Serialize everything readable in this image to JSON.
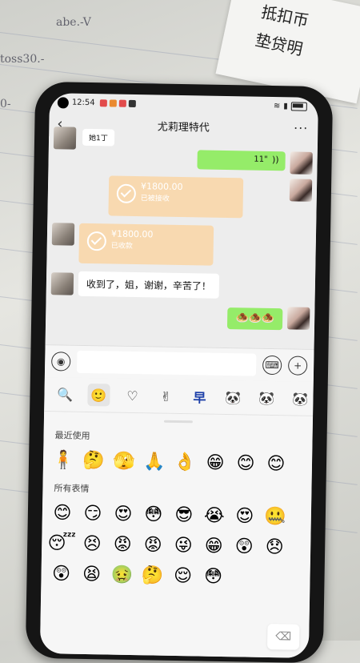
{
  "background": {
    "note_lines": [
      "抵扣币",
      "垫贷明"
    ],
    "scribbles": [
      "abe.-V",
      "toss30.-",
      "0-"
    ]
  },
  "status": {
    "time": "12:54"
  },
  "chat": {
    "title": "尤莉理特代",
    "back_icon": "chevron-left-icon",
    "more_icon": "ellipsis-icon",
    "messages": [
      {
        "side": "left",
        "text": "收到了，姐，谢谢，辛苦了！"
      },
      {
        "side": "right",
        "text": "11\""
      },
      {
        "side": "right",
        "type": "transfer",
        "amount": "¥1800.00",
        "status": "已被接收"
      },
      {
        "side": "left",
        "type": "transfer",
        "amount": "¥1800.00",
        "status": "已收款"
      },
      {
        "side": "right",
        "text": "🧆🧆🧆"
      }
    ],
    "top_partial": "她1丁"
  },
  "input": {
    "placeholder": ""
  },
  "emoji_panel": {
    "tabs": [
      "🔍",
      "🙂",
      "♡",
      "✌",
      "早",
      "🐼",
      "🐼",
      "🐼"
    ],
    "recent_label": "最近使用",
    "all_label": "所有表情",
    "recent": [
      "🧍",
      "🤔",
      "🫣",
      "🙏",
      "👌",
      "😁",
      "😊",
      "😊"
    ],
    "all": [
      "😊",
      "😏",
      "😍",
      "😳",
      "😎",
      "😭",
      "😍",
      "🤐",
      "😴",
      "😣",
      "😡",
      "😡",
      "😜",
      "😁",
      "😲",
      "😞",
      "😲",
      "😫",
      "🤢",
      "🤔",
      "😌",
      "😳",
      "",
      ""
    ]
  }
}
